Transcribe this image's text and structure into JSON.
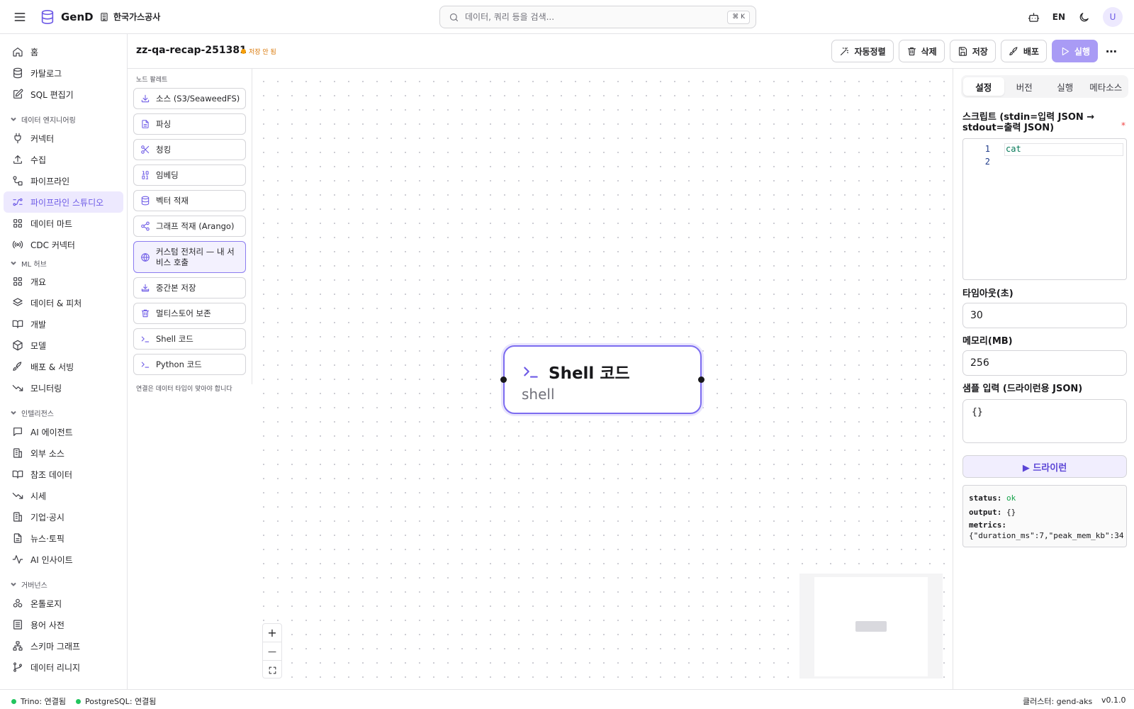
{
  "header": {
    "app_name": "GenD",
    "org_name": "한국가스공사",
    "search_placeholder": "데이터, 쿼리 등을 검색...",
    "search_shortcut": "⌘ K",
    "lang": "EN",
    "avatar_initial": "U"
  },
  "sidebar": {
    "top": [
      {
        "label": "홈",
        "icon": "home-icon"
      },
      {
        "label": "카탈로그",
        "icon": "database-icon"
      },
      {
        "label": "SQL 편집기",
        "icon": "edit-icon"
      }
    ],
    "sections": [
      {
        "title": "데이터 엔지니어링",
        "items": [
          {
            "label": "커넥터",
            "icon": "plug-icon"
          },
          {
            "label": "수집",
            "icon": "upload-icon"
          },
          {
            "label": "파이프라인",
            "icon": "workflow-icon"
          },
          {
            "label": "파이프라인 스튜디오",
            "icon": "route-icon",
            "active": true
          },
          {
            "label": "데이터 마트",
            "icon": "grid-icon"
          },
          {
            "label": "CDC 커넥터",
            "icon": "radio-icon"
          }
        ]
      },
      {
        "title": "ML 허브",
        "items": [
          {
            "label": "개요",
            "icon": "grid-icon"
          },
          {
            "label": "데이터 & 피처",
            "icon": "layers-icon"
          },
          {
            "label": "개발",
            "icon": "book-icon"
          },
          {
            "label": "모델",
            "icon": "box-icon"
          },
          {
            "label": "배포 & 서빙",
            "icon": "rocket-icon"
          },
          {
            "label": "모니터링",
            "icon": "trend-icon"
          }
        ]
      },
      {
        "title": "인텔리전스",
        "items": [
          {
            "label": "AI 에이전트",
            "icon": "chat-icon"
          },
          {
            "label": "외부 소스",
            "icon": "building-icon"
          },
          {
            "label": "참조 데이터",
            "icon": "book-icon"
          },
          {
            "label": "시세",
            "icon": "trend-icon"
          },
          {
            "label": "기업·공시",
            "icon": "building-icon"
          },
          {
            "label": "뉴스·토픽",
            "icon": "file-icon"
          },
          {
            "label": "AI 인사이트",
            "icon": "pulse-icon"
          }
        ]
      },
      {
        "title": "거버넌스",
        "items": [
          {
            "label": "온톨로지",
            "icon": "ontology-icon"
          },
          {
            "label": "용어 사전",
            "icon": "list-icon"
          },
          {
            "label": "스키마 그래프",
            "icon": "network-icon"
          },
          {
            "label": "데이터 리니지",
            "icon": "branch-icon"
          }
        ]
      }
    ]
  },
  "page": {
    "title": "zz-qa-recap-251381",
    "unsaved_label": "저장 안 됨",
    "actions": {
      "autolayout": "자동정렬",
      "delete": "삭제",
      "save": "저장",
      "deploy": "배포",
      "run": "실행"
    }
  },
  "palette": {
    "title": "노드 팔레트",
    "items": [
      {
        "label": "소스 (S3/SeaweedFS)",
        "icon": "download-icon"
      },
      {
        "label": "파싱",
        "icon": "file-icon"
      },
      {
        "label": "청킹",
        "icon": "scissors-icon"
      },
      {
        "label": "임베딩",
        "icon": "binary-icon"
      },
      {
        "label": "벡터 적재",
        "icon": "database-icon"
      },
      {
        "label": "그래프 적재 (Arango)",
        "icon": "share-icon"
      },
      {
        "label": "커스텀 전처리 — 내 서비스 호출",
        "icon": "globe-icon"
      },
      {
        "label": "중간본 저장",
        "icon": "save-tray-icon"
      },
      {
        "label": "멀티스토어 보존",
        "icon": "trash-icon"
      },
      {
        "label": "Shell 코드",
        "icon": "terminal-icon"
      },
      {
        "label": "Python 코드",
        "icon": "terminal-icon"
      }
    ],
    "hint": "연결은 데이터 타입이 맞아야 합니다"
  },
  "canvas": {
    "node": {
      "label": "Shell 코드",
      "subtitle": "shell",
      "icon": "terminal-icon"
    },
    "zoom": {
      "in": "+",
      "out": "—",
      "fit": "⛶"
    }
  },
  "panel": {
    "tabs": [
      "설정",
      "버전",
      "실행",
      "메타소스"
    ],
    "active_tab": "설정",
    "script_label": "스크립트 (stdin=입력 JSON → stdout=출력 JSON)",
    "required_mark": "*",
    "code_lines": [
      {
        "num": "1",
        "text": "cat"
      },
      {
        "num": "2",
        "text": ""
      }
    ],
    "timeout_label": "타임아웃(초)",
    "timeout_value": "30",
    "memory_label": "메모리(MB)",
    "memory_value": "256",
    "sample_label": "샘플 입력 (드라이런용 JSON)",
    "sample_value": "{}",
    "dryrun_label": "▶ 드라이런",
    "result": {
      "status_key": "status:",
      "status_value": "ok",
      "output_key": "output:",
      "output_value": "{}",
      "metrics_key": "metrics:",
      "metrics_value": "{\"duration_ms\":7,\"peak_mem_kb\":34"
    }
  },
  "statusbar": {
    "trino": "Trino: 연결됨",
    "postgres": "PostgreSQL: 연결됨",
    "cluster": "클러스터: gend-aks",
    "version": "v0.1.0"
  },
  "colors": {
    "accent": "#6d5ae6",
    "accent_light": "#ede9fe",
    "ok_green": "#22c55e",
    "unsaved_orange": "#f59e0b"
  }
}
